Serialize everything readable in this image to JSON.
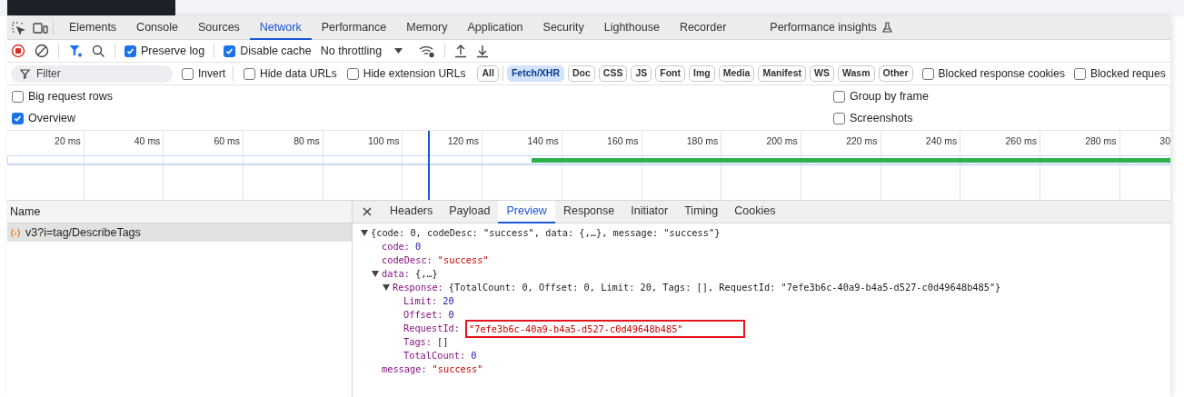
{
  "main_tabs": [
    {
      "label": "Elements",
      "selected": false,
      "experimental": false
    },
    {
      "label": "Console",
      "selected": false,
      "experimental": false
    },
    {
      "label": "Sources",
      "selected": false,
      "experimental": false
    },
    {
      "label": "Network",
      "selected": true,
      "experimental": false
    },
    {
      "label": "Performance",
      "selected": false,
      "experimental": false
    },
    {
      "label": "Memory",
      "selected": false,
      "experimental": false
    },
    {
      "label": "Application",
      "selected": false,
      "experimental": false
    },
    {
      "label": "Security",
      "selected": false,
      "experimental": false
    },
    {
      "label": "Lighthouse",
      "selected": false,
      "experimental": false
    },
    {
      "label": "Recorder",
      "selected": false,
      "experimental": false
    },
    {
      "label": "Performance insights",
      "selected": false,
      "experimental": true
    }
  ],
  "toolbar": {
    "checkboxes": [
      {
        "label": "Preserve log",
        "checked": true
      },
      {
        "label": "Disable cache",
        "checked": true
      }
    ],
    "throttling": "No throttling"
  },
  "filter_bar": {
    "placeholder": "Filter",
    "options": [
      {
        "label": "Invert",
        "checked": false
      },
      {
        "label": "Hide data URLs",
        "checked": false
      },
      {
        "label": "Hide extension URLs",
        "checked": false
      }
    ],
    "types": [
      {
        "label": "All",
        "selected": false
      },
      {
        "label": "Fetch/XHR",
        "selected": true
      },
      {
        "label": "Doc",
        "selected": false
      },
      {
        "label": "CSS",
        "selected": false
      },
      {
        "label": "JS",
        "selected": false
      },
      {
        "label": "Font",
        "selected": false
      },
      {
        "label": "Img",
        "selected": false
      },
      {
        "label": "Media",
        "selected": false
      },
      {
        "label": "Manifest",
        "selected": false
      },
      {
        "label": "WS",
        "selected": false
      },
      {
        "label": "Wasm",
        "selected": false
      },
      {
        "label": "Other",
        "selected": false
      }
    ],
    "more_options": [
      {
        "label": "Blocked response cookies",
        "checked": false
      },
      {
        "label": "Blocked reques",
        "checked": false
      }
    ]
  },
  "settings_left": [
    {
      "label": "Big request rows",
      "checked": false
    },
    {
      "label": "Overview",
      "checked": true
    }
  ],
  "settings_right": [
    {
      "label": "Group by frame",
      "checked": false
    },
    {
      "label": "Screenshots",
      "checked": false
    }
  ],
  "overview": {
    "ticks": [
      "20 ms",
      "40 ms",
      "60 ms",
      "80 ms",
      "100 ms",
      "120 ms",
      "140 ms",
      "160 ms",
      "180 ms",
      "200 ms",
      "220 ms",
      "240 ms",
      "260 ms",
      "280 ms",
      "30"
    ]
  },
  "requests": {
    "column": "Name",
    "rows": [
      {
        "name": "v3?i=tag/DescribeTags",
        "selected": true
      }
    ]
  },
  "detail_tabs": [
    {
      "label": "Headers",
      "selected": false
    },
    {
      "label": "Payload",
      "selected": false
    },
    {
      "label": "Preview",
      "selected": true
    },
    {
      "label": "Response",
      "selected": false
    },
    {
      "label": "Initiator",
      "selected": false
    },
    {
      "label": "Timing",
      "selected": false
    },
    {
      "label": "Cookies",
      "selected": false
    }
  ],
  "preview": [
    {
      "value": "{code: 0, codeDesc: \"success\", data: {,…}, message: \"success\"}",
      "kind": "object",
      "expanded": true,
      "highlighted": false,
      "children": [
        {
          "key": "code:",
          "value": "0",
          "kind": "number",
          "highlighted": false
        },
        {
          "key": "codeDesc:",
          "value": "\"success\"",
          "kind": "string",
          "highlighted": false
        },
        {
          "key": "data:",
          "value": "{,…}",
          "kind": "object",
          "expanded": true,
          "highlighted": false,
          "children": [
            {
              "key": "Response:",
              "value": "{TotalCount: 0, Offset: 0, Limit: 20, Tags: [], RequestId: \"7efe3b6c-40a9-b4a5-d527-c0d49648b485\"}",
              "kind": "object",
              "expanded": true,
              "highlighted": false,
              "children": [
                {
                  "key": "Limit:",
                  "value": "20",
                  "kind": "number",
                  "highlighted": false
                },
                {
                  "key": "Offset:",
                  "value": "0",
                  "kind": "number",
                  "highlighted": false
                },
                {
                  "key": "RequestId:",
                  "value": "\"7efe3b6c-40a9-b4a5-d527-c0d49648b485\"",
                  "kind": "string",
                  "highlighted": true
                },
                {
                  "key": "Tags:",
                  "value": "[]",
                  "kind": "array",
                  "highlighted": false
                },
                {
                  "key": "TotalCount:",
                  "value": "0",
                  "kind": "number",
                  "highlighted": false
                }
              ]
            }
          ]
        },
        {
          "key": "message:",
          "value": "\"success\"",
          "kind": "string",
          "highlighted": false
        }
      ]
    }
  ]
}
